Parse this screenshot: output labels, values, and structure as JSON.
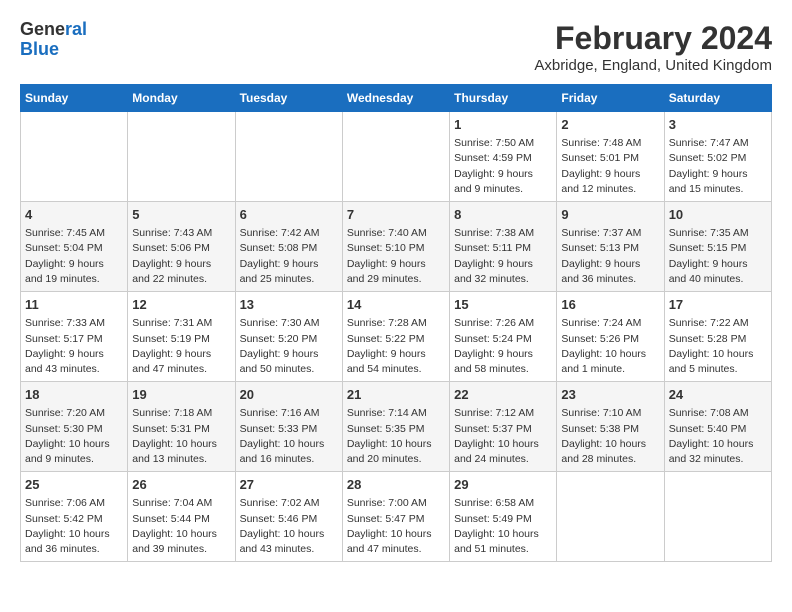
{
  "logo": {
    "line1": "General",
    "line2": "Blue"
  },
  "title": "February 2024",
  "subtitle": "Axbridge, England, United Kingdom",
  "headers": [
    "Sunday",
    "Monday",
    "Tuesday",
    "Wednesday",
    "Thursday",
    "Friday",
    "Saturday"
  ],
  "rows": [
    [
      {
        "day": "",
        "info": ""
      },
      {
        "day": "",
        "info": ""
      },
      {
        "day": "",
        "info": ""
      },
      {
        "day": "",
        "info": ""
      },
      {
        "day": "1",
        "info": "Sunrise: 7:50 AM\nSunset: 4:59 PM\nDaylight: 9 hours\nand 9 minutes."
      },
      {
        "day": "2",
        "info": "Sunrise: 7:48 AM\nSunset: 5:01 PM\nDaylight: 9 hours\nand 12 minutes."
      },
      {
        "day": "3",
        "info": "Sunrise: 7:47 AM\nSunset: 5:02 PM\nDaylight: 9 hours\nand 15 minutes."
      }
    ],
    [
      {
        "day": "4",
        "info": "Sunrise: 7:45 AM\nSunset: 5:04 PM\nDaylight: 9 hours\nand 19 minutes."
      },
      {
        "day": "5",
        "info": "Sunrise: 7:43 AM\nSunset: 5:06 PM\nDaylight: 9 hours\nand 22 minutes."
      },
      {
        "day": "6",
        "info": "Sunrise: 7:42 AM\nSunset: 5:08 PM\nDaylight: 9 hours\nand 25 minutes."
      },
      {
        "day": "7",
        "info": "Sunrise: 7:40 AM\nSunset: 5:10 PM\nDaylight: 9 hours\nand 29 minutes."
      },
      {
        "day": "8",
        "info": "Sunrise: 7:38 AM\nSunset: 5:11 PM\nDaylight: 9 hours\nand 32 minutes."
      },
      {
        "day": "9",
        "info": "Sunrise: 7:37 AM\nSunset: 5:13 PM\nDaylight: 9 hours\nand 36 minutes."
      },
      {
        "day": "10",
        "info": "Sunrise: 7:35 AM\nSunset: 5:15 PM\nDaylight: 9 hours\nand 40 minutes."
      }
    ],
    [
      {
        "day": "11",
        "info": "Sunrise: 7:33 AM\nSunset: 5:17 PM\nDaylight: 9 hours\nand 43 minutes."
      },
      {
        "day": "12",
        "info": "Sunrise: 7:31 AM\nSunset: 5:19 PM\nDaylight: 9 hours\nand 47 minutes."
      },
      {
        "day": "13",
        "info": "Sunrise: 7:30 AM\nSunset: 5:20 PM\nDaylight: 9 hours\nand 50 minutes."
      },
      {
        "day": "14",
        "info": "Sunrise: 7:28 AM\nSunset: 5:22 PM\nDaylight: 9 hours\nand 54 minutes."
      },
      {
        "day": "15",
        "info": "Sunrise: 7:26 AM\nSunset: 5:24 PM\nDaylight: 9 hours\nand 58 minutes."
      },
      {
        "day": "16",
        "info": "Sunrise: 7:24 AM\nSunset: 5:26 PM\nDaylight: 10 hours\nand 1 minute."
      },
      {
        "day": "17",
        "info": "Sunrise: 7:22 AM\nSunset: 5:28 PM\nDaylight: 10 hours\nand 5 minutes."
      }
    ],
    [
      {
        "day": "18",
        "info": "Sunrise: 7:20 AM\nSunset: 5:30 PM\nDaylight: 10 hours\nand 9 minutes."
      },
      {
        "day": "19",
        "info": "Sunrise: 7:18 AM\nSunset: 5:31 PM\nDaylight: 10 hours\nand 13 minutes."
      },
      {
        "day": "20",
        "info": "Sunrise: 7:16 AM\nSunset: 5:33 PM\nDaylight: 10 hours\nand 16 minutes."
      },
      {
        "day": "21",
        "info": "Sunrise: 7:14 AM\nSunset: 5:35 PM\nDaylight: 10 hours\nand 20 minutes."
      },
      {
        "day": "22",
        "info": "Sunrise: 7:12 AM\nSunset: 5:37 PM\nDaylight: 10 hours\nand 24 minutes."
      },
      {
        "day": "23",
        "info": "Sunrise: 7:10 AM\nSunset: 5:38 PM\nDaylight: 10 hours\nand 28 minutes."
      },
      {
        "day": "24",
        "info": "Sunrise: 7:08 AM\nSunset: 5:40 PM\nDaylight: 10 hours\nand 32 minutes."
      }
    ],
    [
      {
        "day": "25",
        "info": "Sunrise: 7:06 AM\nSunset: 5:42 PM\nDaylight: 10 hours\nand 36 minutes."
      },
      {
        "day": "26",
        "info": "Sunrise: 7:04 AM\nSunset: 5:44 PM\nDaylight: 10 hours\nand 39 minutes."
      },
      {
        "day": "27",
        "info": "Sunrise: 7:02 AM\nSunset: 5:46 PM\nDaylight: 10 hours\nand 43 minutes."
      },
      {
        "day": "28",
        "info": "Sunrise: 7:00 AM\nSunset: 5:47 PM\nDaylight: 10 hours\nand 47 minutes."
      },
      {
        "day": "29",
        "info": "Sunrise: 6:58 AM\nSunset: 5:49 PM\nDaylight: 10 hours\nand 51 minutes."
      },
      {
        "day": "",
        "info": ""
      },
      {
        "day": "",
        "info": ""
      }
    ]
  ]
}
